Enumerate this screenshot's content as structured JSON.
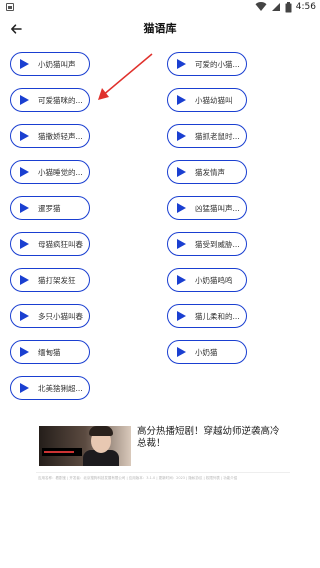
{
  "status_bar": {
    "time": "4:56",
    "icons": [
      "image-icon",
      "wifi-icon",
      "signal-icon",
      "battery-icon"
    ]
  },
  "app_bar": {
    "title": "猫语库",
    "back_icon": "arrow-left-icon"
  },
  "sounds": [
    {
      "label": "小奶猫叫声"
    },
    {
      "label": "可爱的小猫..."
    },
    {
      "label": "可爱猫咪的..."
    },
    {
      "label": "小猫幼猫叫"
    },
    {
      "label": "猫撒娇轻声..."
    },
    {
      "label": "猫抓老鼠时..."
    },
    {
      "label": "小猫睡觉的..."
    },
    {
      "label": "猫发情声"
    },
    {
      "label": "暹罗猫"
    },
    {
      "label": "凶猛猫叫声..."
    },
    {
      "label": "母猫疯狂叫春"
    },
    {
      "label": "猫受到威胁..."
    },
    {
      "label": "猫打架发狂"
    },
    {
      "label": "小奶猫鸣鸣"
    },
    {
      "label": "多只小猫叫春"
    },
    {
      "label": "猫儿柔和的..."
    },
    {
      "label": "缅甸猫"
    },
    {
      "label": "小奶猫"
    },
    {
      "label": "北美猞猁超..."
    }
  ],
  "ad": {
    "headline": "高分热播短剧！穿越幼师逆袭高冷总裁！",
    "footer": "应用名称：看剧宝 | 开发者：北京搜狗科技发展有限公司 | 应用版本：3.1.0 | 更新时间：2023 | 隐私协议 | 权限列表 | 功能介绍"
  },
  "colors": {
    "accent": "#1a3fd1",
    "annotation_arrow": "#e0312c"
  }
}
